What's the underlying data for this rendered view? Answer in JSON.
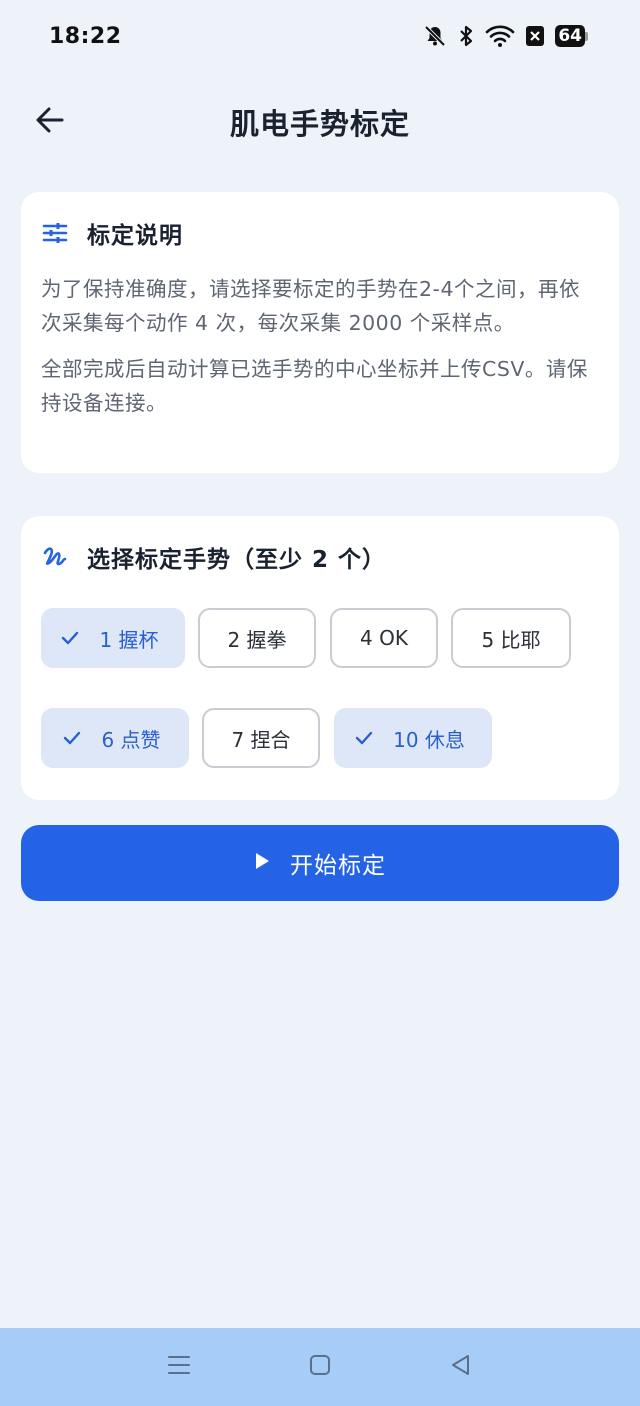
{
  "status_bar": {
    "time": "18:22",
    "battery": "64",
    "icons": [
      "bell-off-icon",
      "bluetooth-icon",
      "wifi-icon",
      "sim-none-icon",
      "battery-icon"
    ]
  },
  "header": {
    "title": "肌电手势标定",
    "back_icon": "arrow-left-icon"
  },
  "info_card": {
    "title": "标定说明",
    "icon": "sliders-icon",
    "paragraph1": "为了保持准确度，请选择要标定的手势在2-4个之间，再依次采集每个动作 4 次，每次采集 2000 个采样点。",
    "paragraph2": "全部完成后自动计算已选手势的中心坐标并上传CSV。请保持设备连接。"
  },
  "select_card": {
    "title": "选择标定手势（至少 2 个）",
    "icon": "gesture-icon",
    "gestures": [
      {
        "label": "1 握杯",
        "selected": true
      },
      {
        "label": "2 握拳",
        "selected": false
      },
      {
        "label": "4 OK",
        "selected": false
      },
      {
        "label": "5 比耶",
        "selected": false
      },
      {
        "label": "6 点赞",
        "selected": true
      },
      {
        "label": "7 捏合",
        "selected": false
      },
      {
        "label": "10 休息",
        "selected": true
      }
    ]
  },
  "start_button": {
    "label": "开始标定",
    "icon": "play-icon"
  },
  "nav_bar": {
    "icons": [
      "menu-icon",
      "home-icon",
      "back-icon"
    ]
  },
  "colors": {
    "accent": "#2563e6",
    "selected_chip_bg": "#dde7f8",
    "selected_chip_text": "#2a5fd0",
    "background": "#eef2f9",
    "nav_bar": "#a6cdf8"
  }
}
